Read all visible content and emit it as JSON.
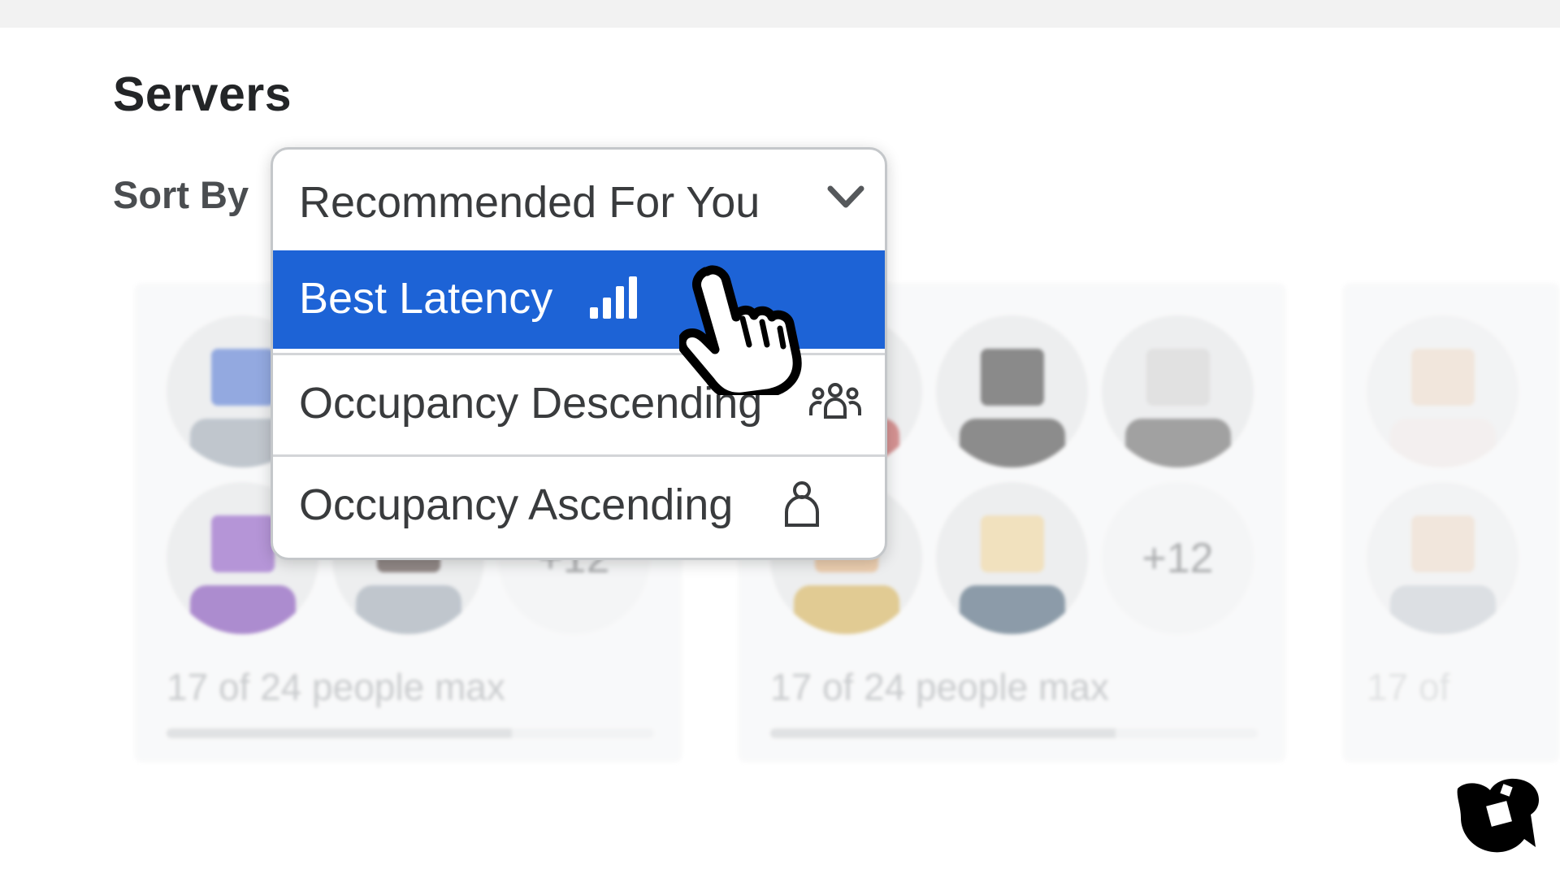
{
  "page": {
    "title": "Servers",
    "sort_label": "Sort By"
  },
  "sort_dropdown": {
    "selected": "Recommended For You",
    "options": [
      {
        "label": "Best Latency",
        "icon": "signal-bars-icon",
        "highlighted": true
      },
      {
        "label": "Occupancy Descending",
        "icon": "people-group-icon",
        "highlighted": false
      },
      {
        "label": "Occupancy Ascending",
        "icon": "person-icon",
        "highlighted": false
      }
    ],
    "highlight_color": "#1d63d6"
  },
  "server_cards": [
    {
      "extra_players": "+12",
      "occupancy": "17 of 24 people max",
      "fill_fraction": 0.708
    },
    {
      "extra_players": "+12",
      "occupancy": "17 of 24 people max",
      "fill_fraction": 0.708
    },
    {
      "occupancy": "17 of"
    }
  ]
}
